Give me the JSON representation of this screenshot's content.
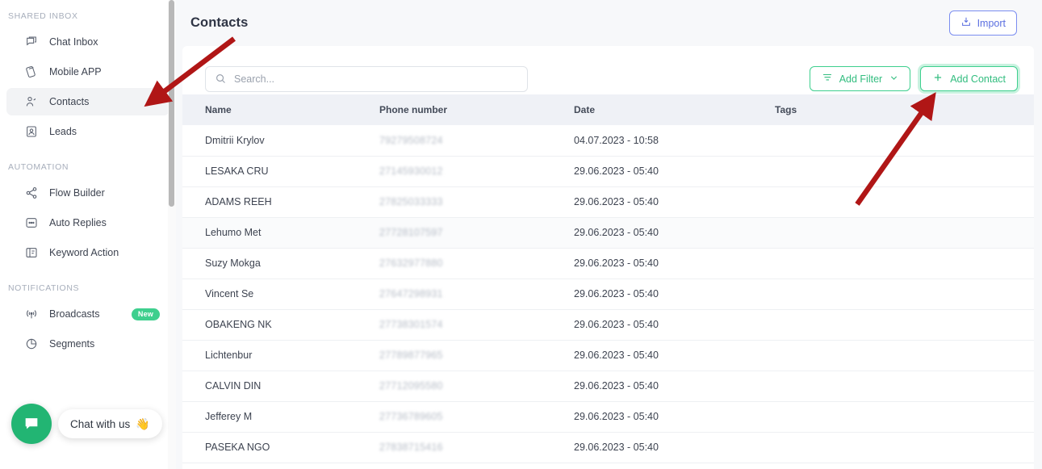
{
  "sidebar": {
    "sections": [
      {
        "label": "SHARED INBOX",
        "items": [
          {
            "label": "Chat Inbox",
            "icon": "chat-icon",
            "active": false,
            "badge": null
          },
          {
            "label": "Mobile APP",
            "icon": "mobile-icon",
            "active": false,
            "badge": null
          },
          {
            "label": "Contacts",
            "icon": "contacts-icon",
            "active": true,
            "badge": null
          },
          {
            "label": "Leads",
            "icon": "leads-icon",
            "active": false,
            "badge": null
          }
        ]
      },
      {
        "label": "AUTOMATION",
        "items": [
          {
            "label": "Flow Builder",
            "icon": "share-icon",
            "active": false,
            "badge": null
          },
          {
            "label": "Auto Replies",
            "icon": "reply-icon",
            "active": false,
            "badge": null
          },
          {
            "label": "Keyword Action",
            "icon": "keyword-icon",
            "active": false,
            "badge": null
          }
        ]
      },
      {
        "label": "NOTIFICATIONS",
        "items": [
          {
            "label": "Broadcasts",
            "icon": "broadcast-icon",
            "active": false,
            "badge": "New"
          },
          {
            "label": "Segments",
            "icon": "segments-icon",
            "active": false,
            "badge": null
          }
        ]
      }
    ]
  },
  "chat_widget": {
    "bubble_icon": "chat-bubble-icon",
    "pill_label": "Chat with us",
    "pill_emoji": "👋",
    "bubble_color": "#22b573"
  },
  "header": {
    "title": "Contacts",
    "import_label": "Import",
    "import_icon": "import-download-icon",
    "import_color": "#5b6fe0"
  },
  "toolbar": {
    "search_placeholder": "Search...",
    "search_value": "",
    "search_icon": "search-icon",
    "add_filter_label": "Add Filter",
    "add_filter_icon": "filter-icon",
    "add_filter_chevron": "chevron-down-icon",
    "add_contact_label": "Add Contact",
    "add_contact_icon": "plus-icon",
    "accent_color": "#3ecf8e"
  },
  "table": {
    "columns": [
      "Name",
      "Phone number",
      "Date",
      "Tags"
    ],
    "rows": [
      {
        "name": "Dmitrii Krylov",
        "phone": "79279508724",
        "date": "04.07.2023 - 10:58",
        "tags": ""
      },
      {
        "name": "LESAKA CRU",
        "phone": "27145930012",
        "date": "29.06.2023 - 05:40",
        "tags": ""
      },
      {
        "name": "ADAMS REEH",
        "phone": "27825033333",
        "date": "29.06.2023 - 05:40",
        "tags": ""
      },
      {
        "name": "Lehumo Met",
        "phone": "27728107597",
        "date": "29.06.2023 - 05:40",
        "tags": ""
      },
      {
        "name": "Suzy Mokga",
        "phone": "27632977880",
        "date": "29.06.2023 - 05:40",
        "tags": ""
      },
      {
        "name": "Vincent Se",
        "phone": "27647298931",
        "date": "29.06.2023 - 05:40",
        "tags": ""
      },
      {
        "name": "OBAKENG NK",
        "phone": "27738301574",
        "date": "29.06.2023 - 05:40",
        "tags": ""
      },
      {
        "name": "Lichtenbur",
        "phone": "27789877965",
        "date": "29.06.2023 - 05:40",
        "tags": ""
      },
      {
        "name": "CALVIN DIN",
        "phone": "27712095580",
        "date": "29.06.2023 - 05:40",
        "tags": ""
      },
      {
        "name": "Jefferey M",
        "phone": "27736789605",
        "date": "29.06.2023 - 05:40",
        "tags": ""
      },
      {
        "name": "PASEKA NGO",
        "phone": "27838715416",
        "date": "29.06.2023 - 05:40",
        "tags": ""
      }
    ]
  },
  "annotations": {
    "color": "#b01616",
    "arrow_1_target": "sidebar-item-contacts",
    "arrow_2_target": "add-contact-button"
  }
}
